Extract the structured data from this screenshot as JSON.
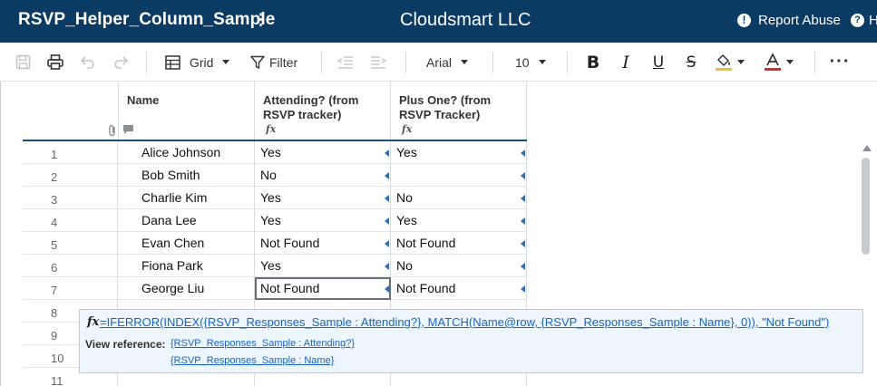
{
  "app": {
    "sheet_title": "RSVP_Helper_Column_Sample",
    "company": "Cloudsmart LLC",
    "report_abuse": "Report Abuse",
    "help_partial": "H"
  },
  "toolbar": {
    "view_label": "Grid",
    "filter_label": "Filter",
    "font_family": "Arial",
    "font_size": "10"
  },
  "columns": [
    {
      "label": "Name",
      "has_formula": false
    },
    {
      "label": "Attending? (from RSVP tracker)",
      "has_formula": true
    },
    {
      "label": "Plus One? (from RSVP Tracker)",
      "has_formula": true
    }
  ],
  "rows": [
    {
      "num": "1",
      "name": "Alice Johnson",
      "attending": "Yes",
      "plus_one": "Yes"
    },
    {
      "num": "2",
      "name": "Bob Smith",
      "attending": "No",
      "plus_one": ""
    },
    {
      "num": "3",
      "name": "Charlie Kim",
      "attending": "Yes",
      "plus_one": "No"
    },
    {
      "num": "4",
      "name": "Dana Lee",
      "attending": "Yes",
      "plus_one": "Yes"
    },
    {
      "num": "5",
      "name": "Evan Chen",
      "attending": "Not Found",
      "plus_one": "Not Found"
    },
    {
      "num": "6",
      "name": "Fiona Park",
      "attending": "Yes",
      "plus_one": "No"
    },
    {
      "num": "7",
      "name": "George Liu",
      "attending": "Not Found",
      "plus_one": "Not Found"
    },
    {
      "num": "8",
      "name": "",
      "attending": "",
      "plus_one": ""
    },
    {
      "num": "9",
      "name": "",
      "attending": "",
      "plus_one": ""
    },
    {
      "num": "10",
      "name": "",
      "attending": "",
      "plus_one": ""
    },
    {
      "num": "11",
      "name": "",
      "attending": "",
      "plus_one": ""
    }
  ],
  "selected_cell": {
    "row": "7",
    "column": "Attending? (from RSVP tracker)"
  },
  "formula_popup": {
    "fx": "fx",
    "formula": "=IFERROR(INDEX({RSVP_Responses_Sample : Attending?}, MATCH(Name@row, {RSVP_Responses_Sample : Name}, 0)), \"Not Found\")",
    "view_reference_label": "View reference:",
    "references": [
      "{RSVP_Responses_Sample : Attending?}",
      "{RSVP_Responses_Sample : Name}"
    ]
  },
  "colors": {
    "titlebar": "#0b3a63",
    "link": "#1a64c8",
    "popup_bg": "#ecf6fc",
    "highlight_underline": "#e8c22c",
    "text_color_underline": "#d62b2b"
  }
}
